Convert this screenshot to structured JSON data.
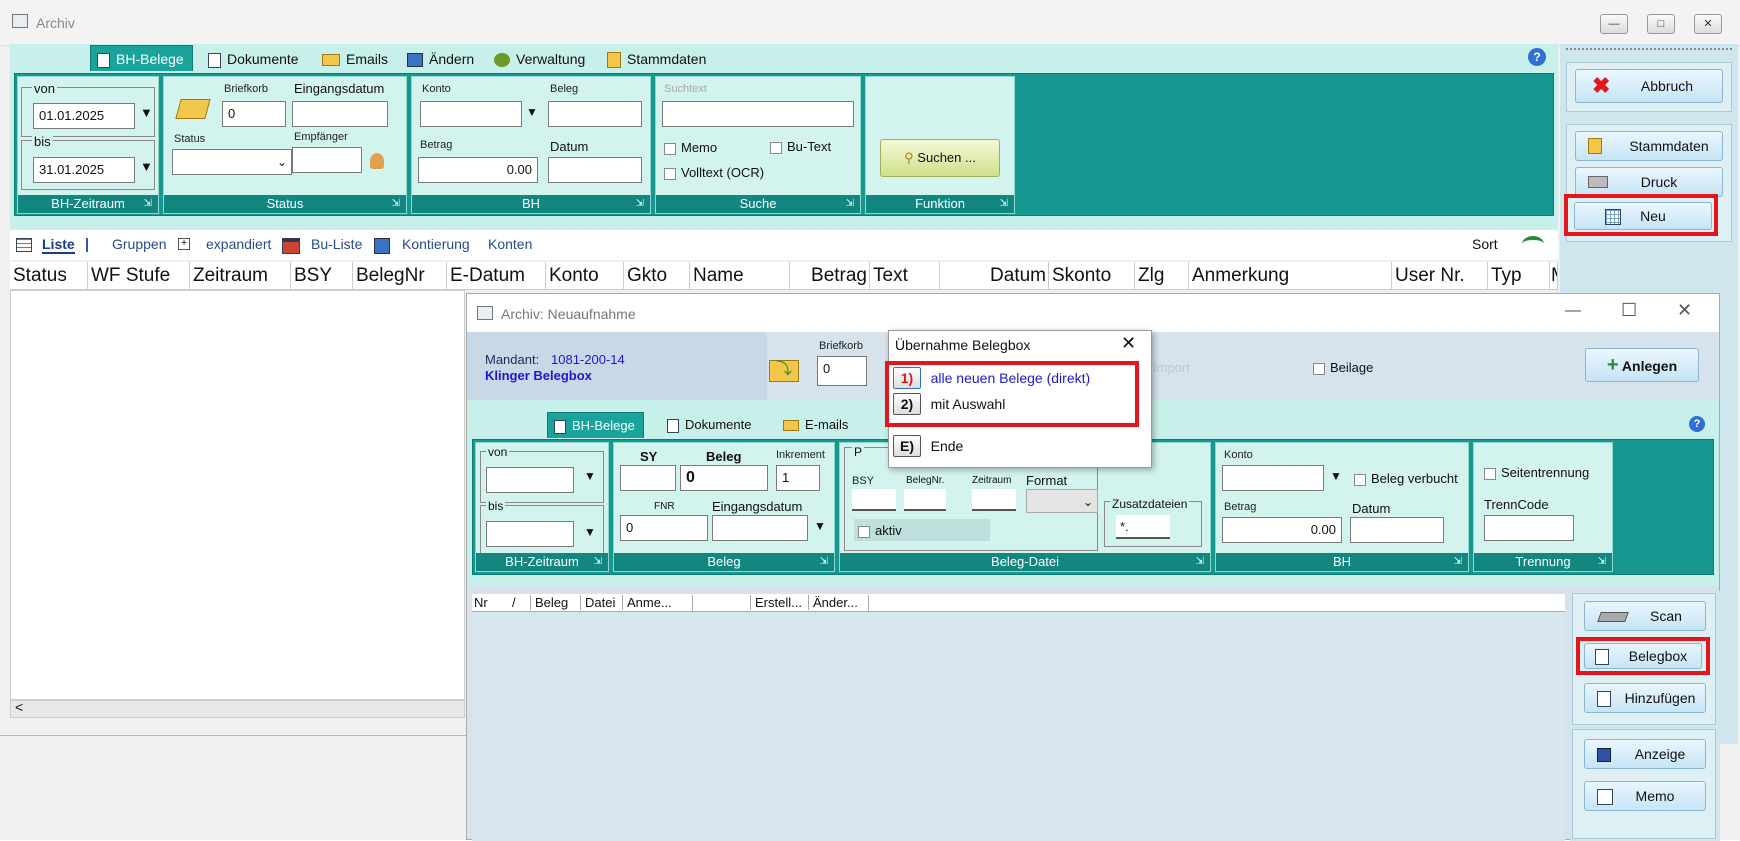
{
  "window": {
    "title": "Archiv"
  },
  "tabs": [
    "BH-Belege",
    "Dokumente",
    "Emails",
    "Ändern",
    "Verwaltung",
    "Stammdaten"
  ],
  "zeitraum": {
    "von_label": "von",
    "von_value": "01.01.2025",
    "bis_label": "bis",
    "bis_value": "31.01.2025",
    "footer": "BH-Zeitraum"
  },
  "status": {
    "briefkorb_label": "Briefkorb",
    "briefkorb_value": "0",
    "eingangsdatum_label": "Eingangsdatum",
    "status_label": "Status",
    "empfaenger_label": "Empfänger",
    "footer": "Status"
  },
  "bh": {
    "konto_label": "Konto",
    "beleg_label": "Beleg",
    "betrag_label": "Betrag",
    "betrag_value": "0.00",
    "datum_label": "Datum",
    "footer": "BH"
  },
  "suche": {
    "suchtext_placeholder": "Suchtext",
    "memo": "Memo",
    "butext": "Bu-Text",
    "volltext": "Volltext (OCR)",
    "footer": "Suche"
  },
  "funktion": {
    "suchen": "Suchen ...",
    "footer": "Funktion"
  },
  "right_panel": {
    "abbruch": "Abbruch",
    "stammdaten": "Stammdaten",
    "druck": "Druck",
    "neu": "Neu"
  },
  "listbar": {
    "liste": "Liste",
    "gruppen": "Gruppen",
    "expandiert": "expandiert",
    "buliste": "Bu-Liste",
    "kontierung": "Kontierung",
    "konten": "Konten",
    "sort": "Sort"
  },
  "columns": [
    "Status",
    "WF Stufe",
    "Zeitraum",
    "BSY",
    "BelegNr",
    "E-Datum",
    "Konto",
    "Gkto",
    "Name",
    "Betrag",
    "Text",
    "Datum",
    "Skonto",
    "Zlg",
    "Anmerkung",
    "User Nr.",
    "Typ",
    "M"
  ],
  "child": {
    "title": "Archiv: Neuaufnahme",
    "mandant_label": "Mandant:",
    "mandant_value": "1081-200-14",
    "mandant_name": "Klinger  Belegbox",
    "briefkorb_label": "Briefkorb",
    "briefkorb_value": "0",
    "beilage": "Beilage",
    "anlegen": "Anlegen",
    "tabs": [
      "BH-Belege",
      "Dokumente",
      "E-mails"
    ],
    "zeitraum": {
      "von": "von",
      "bis": "bis",
      "footer": "BH-Zeitraum"
    },
    "beleg": {
      "sy": "SY",
      "beleg": "Beleg",
      "beleg_value": "0",
      "inkrement": "Inkrement",
      "inkrement_value": "1",
      "fnr": "FNR",
      "fnr_value": "0",
      "eingangsdatum": "Eingangsdatum",
      "footer": "Beleg"
    },
    "belegdatei": {
      "p": "P",
      "bsy": "BSY",
      "belegnr": "BelegNr.",
      "zeitraum": "Zeitraum",
      "format": "Format",
      "aktiv": "aktiv",
      "zusatzdateien": "Zusatzdateien",
      "zusatz_value": "*.",
      "footer": "Beleg-Datei"
    },
    "bh": {
      "konto": "Konto",
      "verbucht": "Beleg verbucht",
      "betrag": "Betrag",
      "betrag_value": "0.00",
      "datum": "Datum",
      "footer": "BH"
    },
    "trennung": {
      "seitentrennung": "Seitentrennung",
      "trenncode": "TrennCode",
      "footer": "Trennung"
    },
    "grid_columns": [
      "Nr",
      "/",
      "Beleg",
      "Datei",
      "Anme...",
      "Erstell...",
      "Änder..."
    ],
    "buttons": {
      "scan": "Scan",
      "belegbox": "Belegbox",
      "hinzufuegen": "Hinzufügen",
      "anzeige": "Anzeige",
      "memo": "Memo"
    },
    "ghost_import": "Import"
  },
  "popup": {
    "title": "Übernahme Belegbox",
    "opt1_key": "1)",
    "opt1": "alle neuen Belege (direkt)",
    "opt2_key": "2)",
    "opt2": "mit Auswahl",
    "opt3_key": "E)",
    "opt3": "Ende"
  },
  "colors": {
    "teal": "#16978f",
    "highlight": "#e3151d",
    "link": "#1a1ad6"
  }
}
